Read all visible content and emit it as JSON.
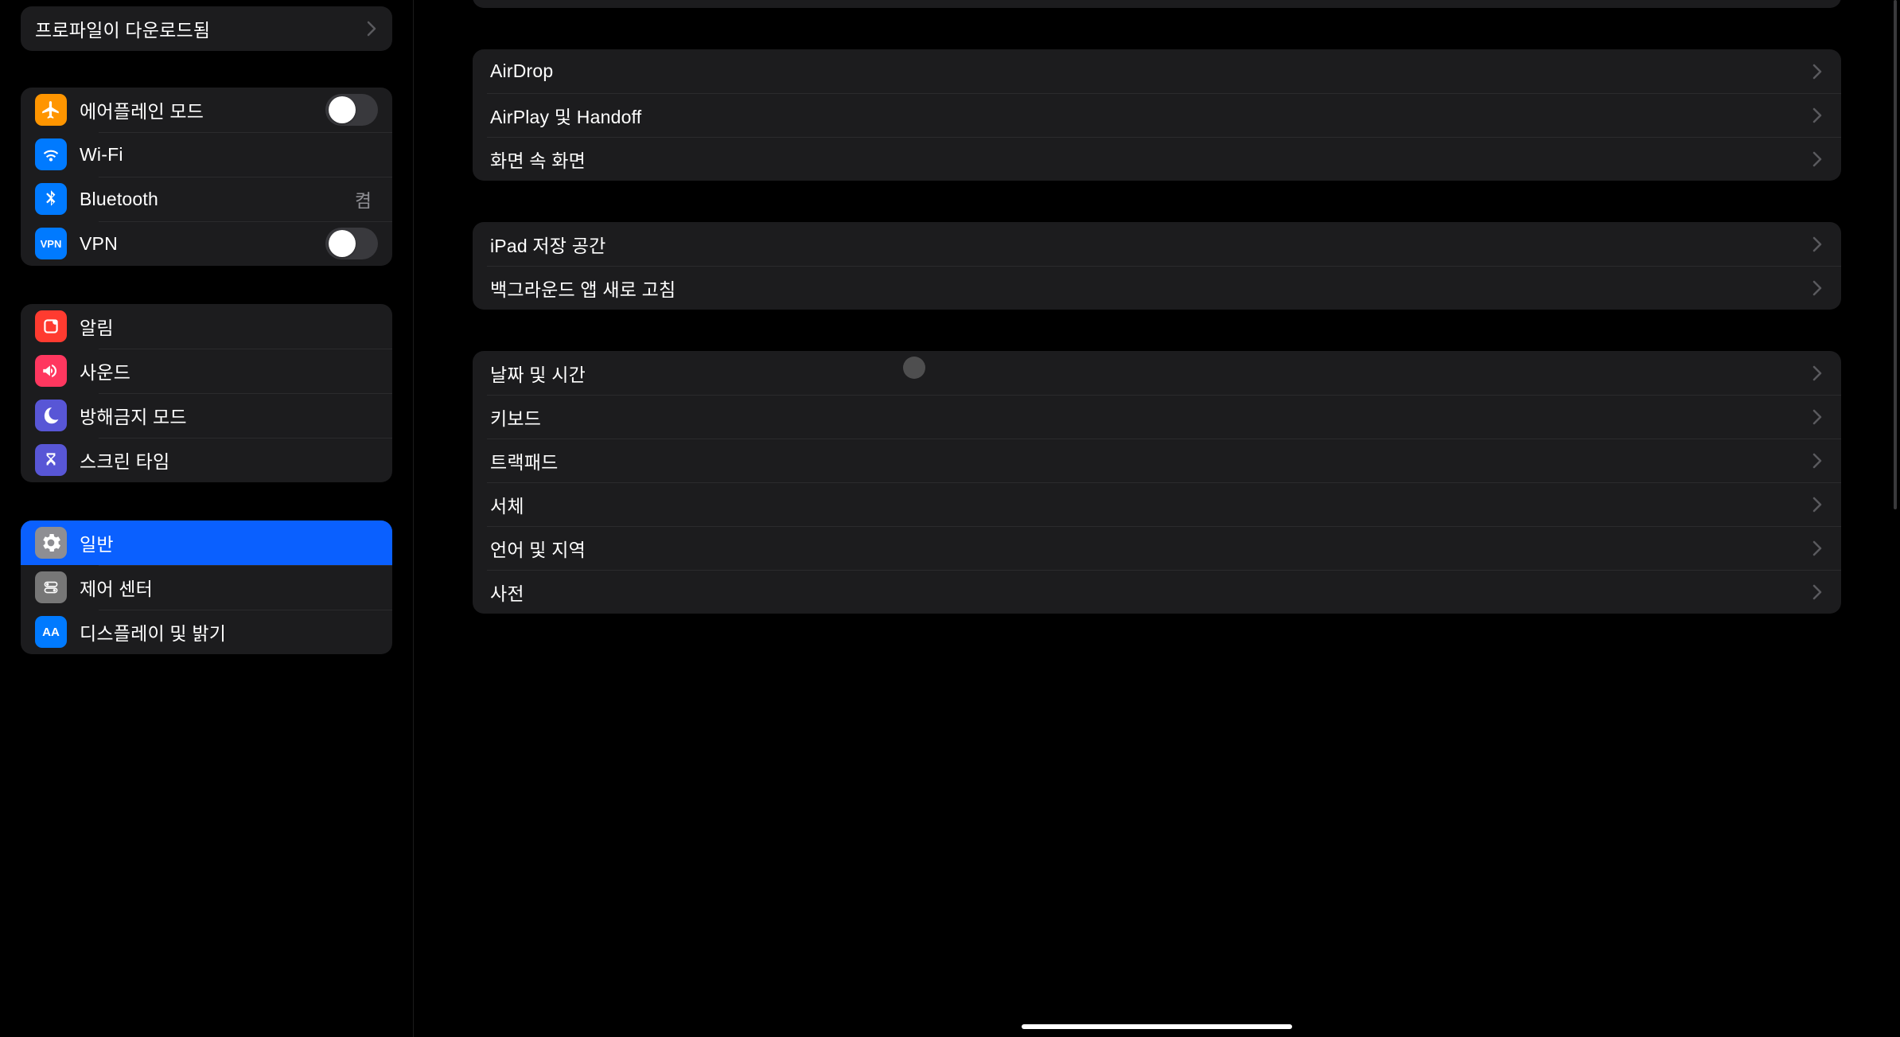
{
  "sidebar": {
    "profile": {
      "label": "프로파일이 다운로드됨"
    },
    "network": {
      "airplane": {
        "label": "에어플레인 모드"
      },
      "wifi": {
        "label": "Wi-Fi",
        "value": ""
      },
      "bluetooth": {
        "label": "Bluetooth",
        "value": "켬"
      },
      "vpn": {
        "label": "VPN"
      }
    },
    "alerts": {
      "notifications": {
        "label": "알림"
      },
      "sounds": {
        "label": "사운드"
      },
      "dnd": {
        "label": "방해금지 모드"
      },
      "screentime": {
        "label": "스크린 타임"
      }
    },
    "system": {
      "general": {
        "label": "일반"
      },
      "controlcenter": {
        "label": "제어 센터"
      },
      "display": {
        "label": "디스플레이 및 밝기"
      }
    }
  },
  "main": {
    "group1": {
      "airdrop": {
        "label": "AirDrop"
      },
      "airplay": {
        "label": "AirPlay 및 Handoff"
      },
      "pip": {
        "label": "화면 속 화면"
      }
    },
    "group2": {
      "storage": {
        "label": "iPad 저장 공간"
      },
      "bgapp": {
        "label": "백그라운드 앱 새로 고침"
      }
    },
    "group3": {
      "datetime": {
        "label": "날짜 및 시간"
      },
      "keyboard": {
        "label": "키보드"
      },
      "trackpad": {
        "label": "트랙패드"
      },
      "fonts": {
        "label": "서체"
      },
      "language": {
        "label": "언어 및 지역"
      },
      "dict": {
        "label": "사전"
      }
    }
  }
}
